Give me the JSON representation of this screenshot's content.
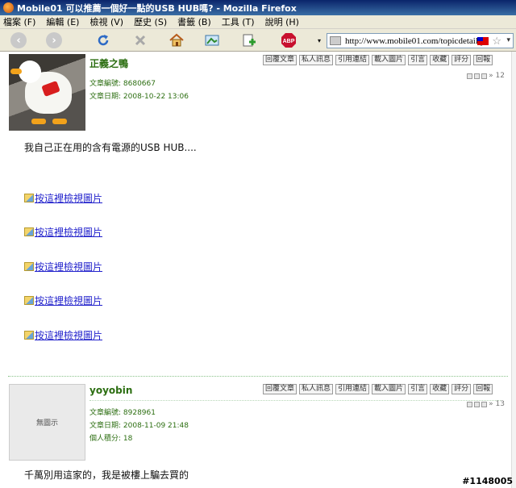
{
  "window": {
    "title": "Mobile01 可以推薦一個好一點的USB HUB嗎? - Mozilla Firefox"
  },
  "menu": [
    "檔案 (F)",
    "編輯 (E)",
    "檢視 (V)",
    "歷史 (S)",
    "書籤 (B)",
    "工具 (T)",
    "說明 (H)"
  ],
  "address": {
    "url": "http://www.mobile01.com/topicdetail.p"
  },
  "post_buttons": [
    "回覆文章",
    "私人訊息",
    "引用連結",
    "載入圖片",
    "引言",
    "收藏",
    "評分",
    "回報"
  ],
  "posts": [
    {
      "username": "正義之鴨",
      "article_no": "文章編號: 8680667",
      "date": "文章日期: 2008-10-22 13:06",
      "floor": "» 12",
      "text": "我自己正在用的含有電源的USB HUB....",
      "image_links": [
        "按這裡檢視圖片",
        "按這裡檢視圖片",
        "按這裡檢視圖片",
        "按這裡檢視圖片",
        "按這裡檢視圖片"
      ]
    },
    {
      "username": "yoyobin",
      "article_no": "文章編號: 8928961",
      "date": "文章日期: 2008-11-09 21:48",
      "points": "個人積分: 18",
      "floor": "» 13",
      "no_image": "無圖示",
      "text": "千萬別用這家的，我是被樓上騙去買的"
    }
  ],
  "watermark": "#1148005"
}
